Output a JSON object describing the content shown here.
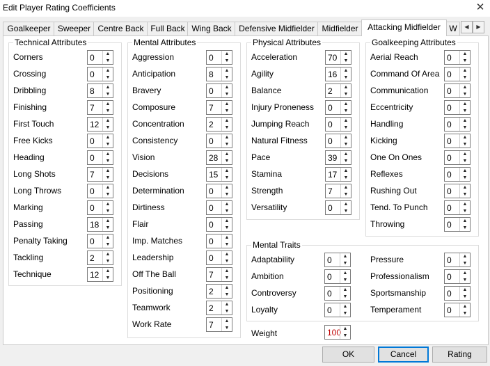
{
  "window": {
    "title": "Edit Player Rating Coefficients",
    "close_glyph": "✕"
  },
  "tabs": [
    {
      "label": "Goalkeeper"
    },
    {
      "label": "Sweeper"
    },
    {
      "label": "Centre Back"
    },
    {
      "label": "Full Back"
    },
    {
      "label": "Wing Back"
    },
    {
      "label": "Defensive Midfielder"
    },
    {
      "label": "Midfielder"
    },
    {
      "label": "Attacking Midfielder",
      "active": true
    },
    {
      "label": "W"
    }
  ],
  "tab_scroll": {
    "left": "◀",
    "right": "▶"
  },
  "spin_glyphs": {
    "up": "▲",
    "down": "▼"
  },
  "groups": {
    "technical": {
      "title": "Technical Attributes",
      "items": [
        {
          "label": "Corners",
          "value": "0"
        },
        {
          "label": "Crossing",
          "value": "0"
        },
        {
          "label": "Dribbling",
          "value": "8"
        },
        {
          "label": "Finishing",
          "value": "7"
        },
        {
          "label": "First Touch",
          "value": "12"
        },
        {
          "label": "Free Kicks",
          "value": "0"
        },
        {
          "label": "Heading",
          "value": "0"
        },
        {
          "label": "Long Shots",
          "value": "7"
        },
        {
          "label": "Long Throws",
          "value": "0"
        },
        {
          "label": "Marking",
          "value": "0"
        },
        {
          "label": "Passing",
          "value": "18"
        },
        {
          "label": "Penalty Taking",
          "value": "0"
        },
        {
          "label": "Tackling",
          "value": "2"
        },
        {
          "label": "Technique",
          "value": "12"
        }
      ]
    },
    "mental": {
      "title": "Mental Attributes",
      "items": [
        {
          "label": "Aggression",
          "value": "0"
        },
        {
          "label": "Anticipation",
          "value": "8"
        },
        {
          "label": "Bravery",
          "value": "0"
        },
        {
          "label": "Composure",
          "value": "7"
        },
        {
          "label": "Concentration",
          "value": "2"
        },
        {
          "label": "Consistency",
          "value": "0"
        },
        {
          "label": "Vision",
          "value": "28"
        },
        {
          "label": "Decisions",
          "value": "15"
        },
        {
          "label": "Determination",
          "value": "0"
        },
        {
          "label": "Dirtiness",
          "value": "0"
        },
        {
          "label": "Flair",
          "value": "0"
        },
        {
          "label": "Imp. Matches",
          "value": "0"
        },
        {
          "label": "Leadership",
          "value": "0"
        },
        {
          "label": "Off The Ball",
          "value": "7"
        },
        {
          "label": "Positioning",
          "value": "2"
        },
        {
          "label": "Teamwork",
          "value": "2"
        },
        {
          "label": "Work Rate",
          "value": "7"
        }
      ]
    },
    "physical": {
      "title": "Physical Attributes",
      "items": [
        {
          "label": "Acceleration",
          "value": "70"
        },
        {
          "label": "Agility",
          "value": "16"
        },
        {
          "label": "Balance",
          "value": "2"
        },
        {
          "label": "Injury Proneness",
          "value": "0"
        },
        {
          "label": "Jumping Reach",
          "value": "0"
        },
        {
          "label": "Natural Fitness",
          "value": "0"
        },
        {
          "label": "Pace",
          "value": "39"
        },
        {
          "label": "Stamina",
          "value": "17"
        },
        {
          "label": "Strength",
          "value": "7"
        },
        {
          "label": "Versatility",
          "value": "0"
        }
      ]
    },
    "goalkeeping": {
      "title": "Goalkeeping Attributes",
      "items": [
        {
          "label": "Aerial Reach",
          "value": "0"
        },
        {
          "label": "Command Of Area",
          "value": "0"
        },
        {
          "label": "Communication",
          "value": "0"
        },
        {
          "label": "Eccentricity",
          "value": "0"
        },
        {
          "label": "Handling",
          "value": "0"
        },
        {
          "label": "Kicking",
          "value": "0"
        },
        {
          "label": "One On Ones",
          "value": "0"
        },
        {
          "label": "Reflexes",
          "value": "0"
        },
        {
          "label": "Rushing Out",
          "value": "0"
        },
        {
          "label": "Tend. To Punch",
          "value": "0"
        },
        {
          "label": "Throwing",
          "value": "0"
        }
      ]
    },
    "traits": {
      "title": "Mental Traits",
      "left": [
        {
          "label": "Adaptability",
          "value": "0"
        },
        {
          "label": "Ambition",
          "value": "0"
        },
        {
          "label": "Controversy",
          "value": "0"
        },
        {
          "label": "Loyalty",
          "value": "0"
        }
      ],
      "right": [
        {
          "label": "Pressure",
          "value": "0"
        },
        {
          "label": "Professionalism",
          "value": "0"
        },
        {
          "label": "Sportsmanship",
          "value": "0"
        },
        {
          "label": "Temperament",
          "value": "0"
        }
      ]
    }
  },
  "weight": {
    "label": "Weight",
    "value": "100"
  },
  "buttons": {
    "ok": "OK",
    "cancel": "Cancel",
    "rating": "Rating"
  }
}
